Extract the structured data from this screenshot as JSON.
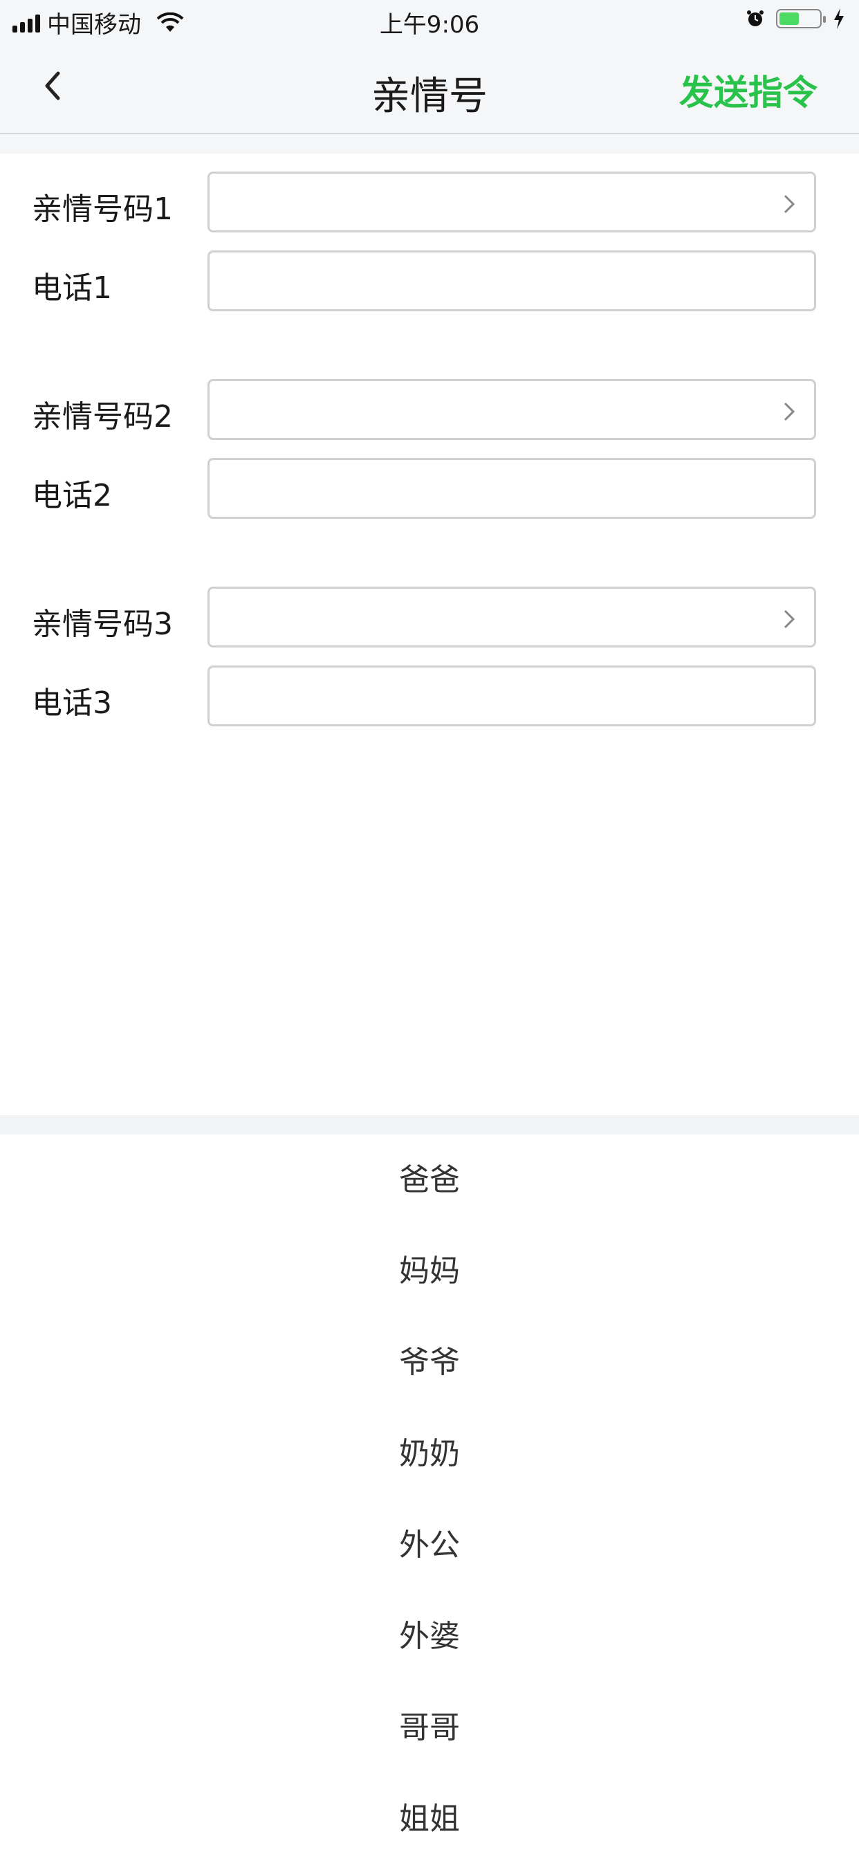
{
  "status_bar": {
    "carrier": "中国移动",
    "time": "上午9:06",
    "battery_level": 0.5
  },
  "nav": {
    "title": "亲情号",
    "action": "发送指令"
  },
  "form": {
    "groups": [
      {
        "relation_label": "亲情号码1",
        "phone_label": "电话1",
        "relation_value": "",
        "phone_value": ""
      },
      {
        "relation_label": "亲情号码2",
        "phone_label": "电话2",
        "relation_value": "",
        "phone_value": ""
      },
      {
        "relation_label": "亲情号码3",
        "phone_label": "电话3",
        "relation_value": "",
        "phone_value": ""
      }
    ]
  },
  "picker": {
    "options": [
      "爸爸",
      "妈妈",
      "爷爷",
      "奶奶",
      "外公",
      "外婆",
      "哥哥",
      "姐姐"
    ]
  },
  "colors": {
    "accent_green": "#29c24a",
    "background_gray": "#f5f6f8"
  }
}
